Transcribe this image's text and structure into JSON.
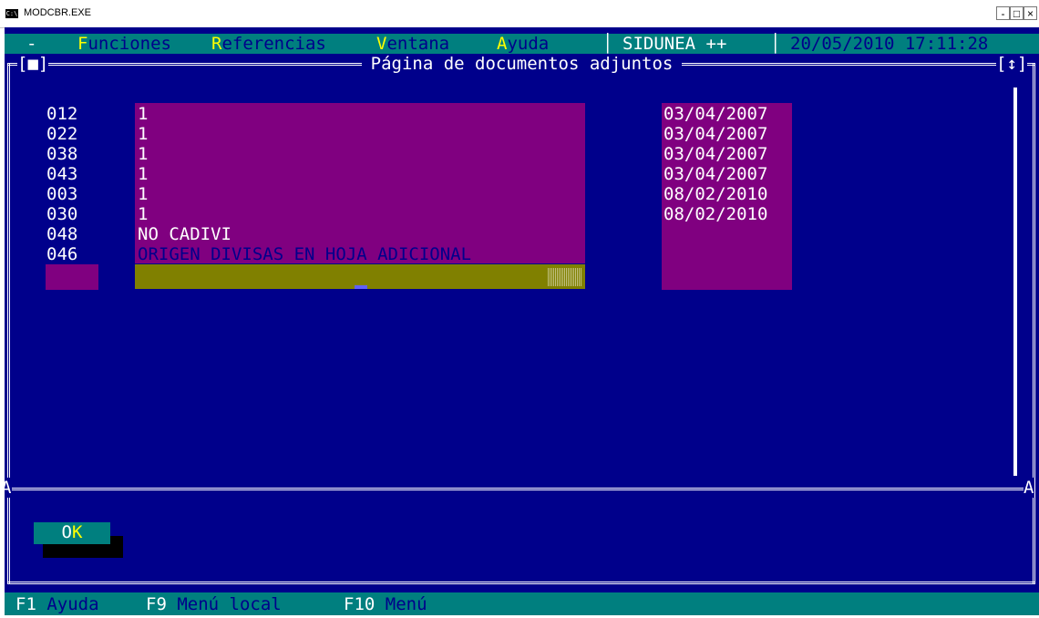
{
  "window": {
    "title": "MODCBR.EXE",
    "icon_text": "C:\\",
    "min_label": "-",
    "max_label": "□",
    "close_label": "×"
  },
  "menubar": {
    "system": "-",
    "items": [
      {
        "hotkey": "F",
        "rest": "unciones"
      },
      {
        "hotkey": "R",
        "rest": "eferencias"
      },
      {
        "hotkey": "V",
        "rest": "entana"
      },
      {
        "hotkey": "A",
        "rest": "yuda"
      }
    ],
    "app_badge": "SIDUNEA ++",
    "datetime": "20/05/2010 17:11:28"
  },
  "page": {
    "title": "Página de documentos adjuntos",
    "left_box": "[■]",
    "right_box": "[↕]",
    "scroll_marker": "A"
  },
  "rows": [
    {
      "code": "012",
      "value": "1",
      "date": "03/04/2007"
    },
    {
      "code": "022",
      "value": "1",
      "date": "03/04/2007"
    },
    {
      "code": "038",
      "value": "1",
      "date": "03/04/2007"
    },
    {
      "code": "043",
      "value": "1",
      "date": "03/04/2007"
    },
    {
      "code": "003",
      "value": "1",
      "date": "08/02/2010"
    },
    {
      "code": "030",
      "value": "1",
      "date": "08/02/2010"
    },
    {
      "code": "048",
      "value": "NO CADIVI",
      "date": ""
    },
    {
      "code": "046",
      "value": "ORIGEN DIVISAS EN HOJA ADICIONAL",
      "date": ""
    }
  ],
  "ok_button": {
    "prefix": "O",
    "hotkey": "K"
  },
  "statusbar": [
    {
      "key": "F1",
      "label": "Ayuda"
    },
    {
      "key": "F9",
      "label": "Menú local"
    },
    {
      "key": "F10",
      "label": "Menú"
    }
  ],
  "colors": {
    "background": "#00008b",
    "accent": "#007f7f",
    "field": "#800080",
    "active_field": "#808000",
    "hotkey": "#ffff00"
  }
}
